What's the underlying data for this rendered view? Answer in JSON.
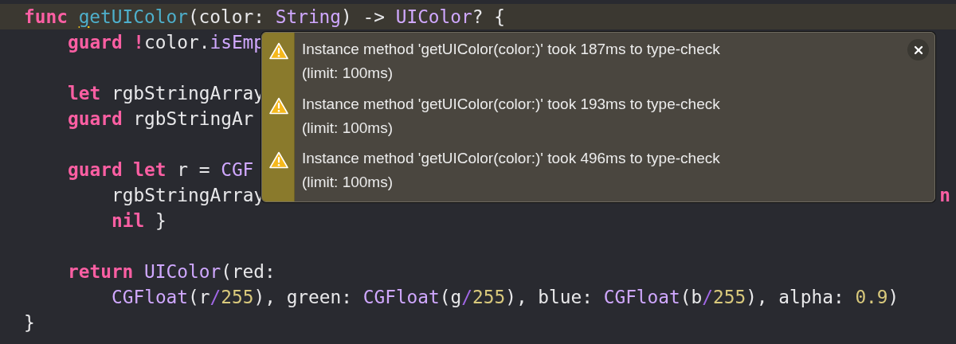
{
  "editor": {
    "lines": [
      {
        "highlighted": true,
        "tokens": [
          {
            "kind": "keyword",
            "text": "func "
          },
          {
            "kind": "declaration",
            "text": "g",
            "underlined": true
          },
          {
            "kind": "declaration",
            "text": "etUIColor",
            "underlined": false
          },
          {
            "kind": "plain",
            "text": "(color: "
          },
          {
            "kind": "type",
            "text": "String"
          },
          {
            "kind": "plain",
            "text": ") -> "
          },
          {
            "kind": "type",
            "text": "UIColor"
          },
          {
            "kind": "plain",
            "text": "? {"
          }
        ],
        "children": [
          {
            "highlighted": false,
            "tokens": [
              {
                "kind": "keyword",
                "text": "guard !"
              },
              {
                "kind": "plain",
                "text": "color."
              },
              {
                "kind": "type",
                "text": "isEmp"
              }
            ]
          },
          {
            "highlighted": false,
            "gap_before": true,
            "tokens": [
              {
                "kind": "keyword",
                "text": "let "
              },
              {
                "kind": "plain",
                "text": "rgbStringArray"
              }
            ]
          },
          {
            "highlighted": false,
            "tokens": [
              {
                "kind": "keyword",
                "text": "guard "
              },
              {
                "kind": "plain",
                "text": "rgbStringAr"
              }
            ]
          },
          {
            "highlighted": false,
            "gap_before": true,
            "tokens": [
              {
                "kind": "keyword",
                "text": "guard let "
              },
              {
                "kind": "plain",
                "text": "r = "
              },
              {
                "kind": "type",
                "text": "CGF"
              }
            ],
            "children": [
              {
                "highlighted": false,
                "tokens": [
                  {
                    "kind": "plain",
                    "text": "rgbStringArray"
                  }
                ],
                "tail": [
                  {
                    "kind": "keyword",
                    "text": "n"
                  }
                ]
              },
              {
                "highlighted": false,
                "tokens": [
                  {
                    "kind": "keyword",
                    "text": "nil "
                  },
                  {
                    "kind": "plain",
                    "text": "}"
                  }
                ]
              }
            ]
          },
          {
            "highlighted": false,
            "gap_before": true,
            "tokens": [
              {
                "kind": "keyword",
                "text": "return "
              },
              {
                "kind": "type",
                "text": "UIColor"
              },
              {
                "kind": "plain",
                "text": "(red:"
              }
            ],
            "children": [
              {
                "highlighted": false,
                "tokens": [
                  {
                    "kind": "type",
                    "text": "CGFloat"
                  },
                  {
                    "kind": "plain",
                    "text": "(r"
                  },
                  {
                    "kind": "operator",
                    "text": "/"
                  },
                  {
                    "kind": "number",
                    "text": "255"
                  },
                  {
                    "kind": "plain",
                    "text": "), green: "
                  },
                  {
                    "kind": "type",
                    "text": "CGFloat"
                  },
                  {
                    "kind": "plain",
                    "text": "(g"
                  },
                  {
                    "kind": "operator",
                    "text": "/"
                  },
                  {
                    "kind": "number",
                    "text": "255"
                  },
                  {
                    "kind": "plain",
                    "text": "), blue: "
                  },
                  {
                    "kind": "type",
                    "text": "CGFloat"
                  },
                  {
                    "kind": "plain",
                    "text": "(b"
                  },
                  {
                    "kind": "operator",
                    "text": "/"
                  },
                  {
                    "kind": "number",
                    "text": "255"
                  },
                  {
                    "kind": "plain",
                    "text": "), alpha: "
                  },
                  {
                    "kind": "number",
                    "text": "0.9"
                  },
                  {
                    "kind": "plain",
                    "text": ")"
                  }
                ]
              }
            ]
          }
        ]
      },
      {
        "highlighted": false,
        "tokens": [
          {
            "kind": "plain",
            "text": "}"
          }
        ]
      }
    ]
  },
  "popup": {
    "items": [
      {
        "kind": "warning",
        "message": "Instance method 'getUIColor(color:)' took 187ms to type-check",
        "detail": "(limit: 100ms)"
      },
      {
        "kind": "warning",
        "message": "Instance method 'getUIColor(color:)' took 193ms to type-check",
        "detail": "(limit: 100ms)"
      },
      {
        "kind": "warning",
        "message": "Instance method 'getUIColor(color:)' took 496ms to type-check",
        "detail": "(limit: 100ms)"
      }
    ]
  }
}
